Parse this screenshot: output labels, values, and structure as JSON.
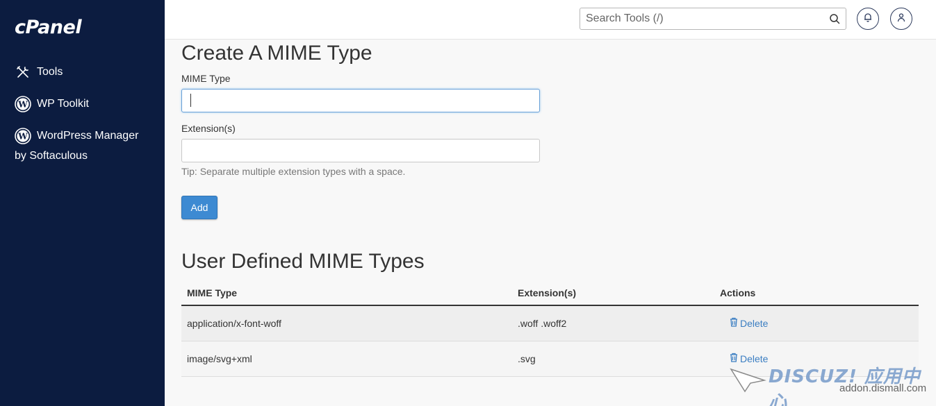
{
  "sidebar": {
    "logo": "cPanel",
    "items": [
      {
        "label": "Tools",
        "icon": "tools-icon"
      },
      {
        "label": "WP Toolkit",
        "icon": "wordpress-icon"
      },
      {
        "label": "WordPress Manager",
        "label_line2": "by Softaculous",
        "icon": "wordpress-icon"
      }
    ]
  },
  "topbar": {
    "search_placeholder": "Search Tools (/)",
    "icons": [
      "search-icon",
      "bell-icon",
      "user-icon"
    ]
  },
  "create_form": {
    "title": "Create A MIME Type",
    "mime_label": "MIME Type",
    "mime_value": "",
    "ext_label": "Extension(s)",
    "ext_value": "",
    "tip": "Tip: Separate multiple extension types with a space.",
    "add_label": "Add"
  },
  "user_defined": {
    "title": "User Defined MIME Types",
    "columns": [
      "MIME Type",
      "Extension(s)",
      "Actions"
    ],
    "rows": [
      {
        "mime": "application/x-font-woff",
        "ext": ".woff .woff2",
        "action": "Delete"
      },
      {
        "mime": "image/svg+xml",
        "ext": ".svg",
        "action": "Delete"
      }
    ]
  },
  "watermark": {
    "brand": "DISCUZ! 应用中心",
    "url": "addon.dismall.com"
  },
  "colors": {
    "sidebar_bg": "#0c1c40",
    "primary_button": "#3d8ad2",
    "link": "#3b7ec2"
  }
}
